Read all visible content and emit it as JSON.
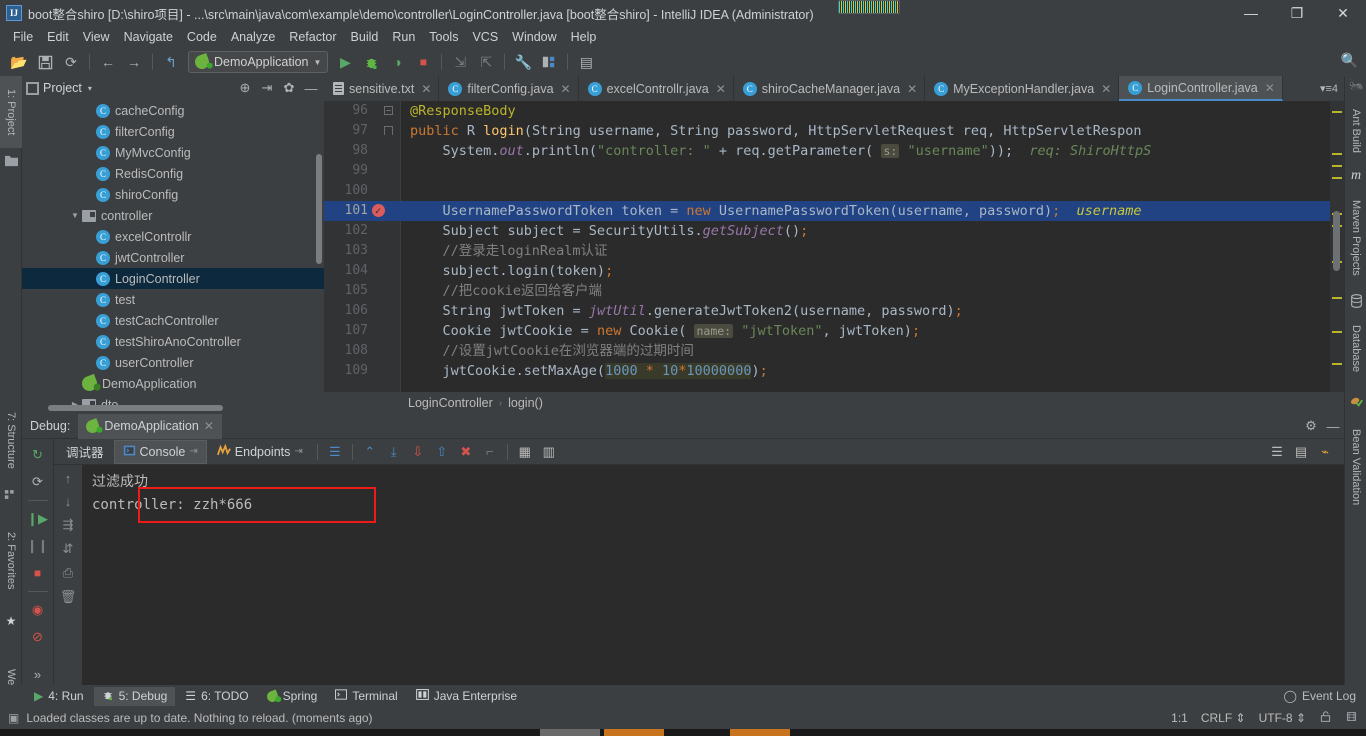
{
  "window": {
    "title": "boot整合shiro [D:\\shiro项目] - ...\\src\\main\\java\\com\\example\\demo\\controller\\LoginController.java [boot整合shiro] - IntelliJ IDEA (Administrator)",
    "app_icon": "IJ",
    "minimize": "—",
    "maximize": "❐",
    "close": "✕"
  },
  "menu": {
    "items": [
      "File",
      "Edit",
      "View",
      "Navigate",
      "Code",
      "Analyze",
      "Refactor",
      "Build",
      "Run",
      "Tools",
      "VCS",
      "Window",
      "Help"
    ]
  },
  "toolbar": {
    "open_icon": "📂",
    "save_icon": "💾",
    "sync_icon": "⟳",
    "back_icon": "←",
    "forward_icon": "→",
    "rollback_icon": "↰",
    "run_config": "DemoApplication",
    "run_icon": "▶",
    "debug_icon": "🐞",
    "run_coverage_icon": "◑",
    "stop_icon": "■",
    "attach_icon": "⇲",
    "profile_icon": "⇱",
    "settings_icon": "🔧",
    "project_structure_icon": "▧",
    "db_icon": "▤",
    "search_icon": "🔍"
  },
  "left_strip": {
    "tabs": [
      {
        "label": "1: Project",
        "active": true
      },
      {
        "label": "7: Structure",
        "active": false
      },
      {
        "label": "2: Favorites",
        "active": false
      },
      {
        "label": "Web",
        "active": false
      }
    ]
  },
  "right_strip": {
    "tabs": [
      {
        "label": "Ant Build"
      },
      {
        "label": "Maven Projects"
      },
      {
        "label": "Database"
      },
      {
        "label": "Bean Validation"
      }
    ]
  },
  "project_panel": {
    "title": "Project",
    "caret": "▾",
    "icons": [
      "collapse-all-icon",
      "expand-icon",
      "gear-icon",
      "hide-icon"
    ],
    "tree": [
      {
        "label": "cacheConfig",
        "indent": 4,
        "icon": "class",
        "arrow": "",
        "selected": false
      },
      {
        "label": "filterConfig",
        "indent": 4,
        "icon": "class",
        "arrow": "",
        "selected": false
      },
      {
        "label": "MyMvcConfig",
        "indent": 4,
        "icon": "class",
        "arrow": "",
        "selected": false
      },
      {
        "label": "RedisConfig",
        "indent": 4,
        "icon": "class",
        "arrow": "",
        "selected": false
      },
      {
        "label": "shiroConfig",
        "indent": 4,
        "icon": "class",
        "arrow": "",
        "selected": false
      },
      {
        "label": "controller",
        "indent": 3,
        "icon": "folder",
        "arrow": "▼",
        "selected": false
      },
      {
        "label": "excelControllr",
        "indent": 4,
        "icon": "class",
        "arrow": "",
        "selected": false
      },
      {
        "label": "jwtController",
        "indent": 4,
        "icon": "class",
        "arrow": "",
        "selected": false
      },
      {
        "label": "LoginController",
        "indent": 4,
        "icon": "class",
        "arrow": "",
        "selected": true
      },
      {
        "label": "test",
        "indent": 4,
        "icon": "class",
        "arrow": "",
        "selected": false
      },
      {
        "label": "testCachController",
        "indent": 4,
        "icon": "class",
        "arrow": "",
        "selected": false
      },
      {
        "label": "testShiroAnoController",
        "indent": 4,
        "icon": "class",
        "arrow": "",
        "selected": false
      },
      {
        "label": "userController",
        "indent": 4,
        "icon": "class",
        "arrow": "",
        "selected": false
      },
      {
        "label": "DemoApplication",
        "indent": 3,
        "icon": "app",
        "arrow": "",
        "selected": false
      },
      {
        "label": "dto",
        "indent": 3,
        "icon": "folder",
        "arrow": "▶",
        "selected": false
      }
    ]
  },
  "editor": {
    "tabs": [
      {
        "label": "sensitive.txt",
        "icon": "txt",
        "active": false
      },
      {
        "label": "filterConfig.java",
        "icon": "class",
        "active": false
      },
      {
        "label": "excelControllr.java",
        "icon": "class",
        "active": false
      },
      {
        "label": "shiroCacheManager.java",
        "icon": "class",
        "active": false
      },
      {
        "label": "MyExceptionHandler.java",
        "icon": "class",
        "active": false
      },
      {
        "label": "LoginController.java",
        "icon": "class",
        "active": true
      }
    ],
    "tab_overflow": "▾≡4",
    "breadcrumb": [
      "LoginController",
      "login()"
    ],
    "breadcrumb_sep": "›",
    "lines": [
      {
        "num": "96",
        "fold": "minus",
        "breakpoint": false,
        "highlight": false
      },
      {
        "num": "97",
        "fold": "arrow",
        "breakpoint": false,
        "highlight": false
      },
      {
        "num": "98",
        "fold": "",
        "breakpoint": false,
        "highlight": false
      },
      {
        "num": "99",
        "fold": "",
        "breakpoint": false,
        "highlight": false
      },
      {
        "num": "100",
        "fold": "",
        "breakpoint": false,
        "highlight": false
      },
      {
        "num": "101",
        "fold": "",
        "breakpoint": true,
        "highlight": true
      },
      {
        "num": "102",
        "fold": "",
        "breakpoint": false,
        "highlight": false
      },
      {
        "num": "103",
        "fold": "",
        "breakpoint": false,
        "highlight": false
      },
      {
        "num": "104",
        "fold": "",
        "breakpoint": false,
        "highlight": false
      },
      {
        "num": "105",
        "fold": "",
        "breakpoint": false,
        "highlight": false
      },
      {
        "num": "106",
        "fold": "",
        "breakpoint": false,
        "highlight": false
      },
      {
        "num": "107",
        "fold": "",
        "breakpoint": false,
        "highlight": false
      },
      {
        "num": "108",
        "fold": "",
        "breakpoint": false,
        "highlight": false
      },
      {
        "num": "109",
        "fold": "",
        "breakpoint": false,
        "highlight": false
      }
    ],
    "code_text": [
      "@ResponseBody",
      "public R login(String username, String password, HttpServletRequest req, HttpServletRespon",
      "    System.out.println(\"controller: \" + req.getParameter( s: \"username\"));   req: ShiroHttpS",
      "",
      "",
      "    UsernamePasswordToken token = new UsernamePasswordToken(username, password);   username",
      "    Subject subject = SecurityUtils.getSubject();",
      "    //登录走loginRealm认证",
      "    subject.login(token);",
      "    //把cookie返回给客户端",
      "    String jwtToken = jwtUtil.generateJwtToken2(username, password);",
      "    Cookie jwtCookie = new Cookie( name: \"jwtToken\", jwtToken);",
      "    //设置jwtCookie在浏览器端的过期时间",
      "    jwtCookie.setMaxAge(1000 * 10*10000000);"
    ]
  },
  "debug": {
    "header_label": "Debug:",
    "session_tab": "DemoApplication",
    "close_icon": "✕",
    "settings_icon": "⚙",
    "hide_icon": "—",
    "side_tools": [
      "rerun-icon",
      "restart-icon",
      "resume-icon",
      "pause-icon",
      "stop-icon",
      "mute-breakpoints-icon",
      "view-breakpoints-icon",
      "more-icon"
    ],
    "tabs": [
      {
        "label": "调试器",
        "active": false,
        "icon": ""
      },
      {
        "label": "Console",
        "active": true,
        "icon": "console",
        "sup": "⇥"
      },
      {
        "label": "Endpoints",
        "active": false,
        "icon": "endpoints",
        "sup": "⇥"
      }
    ],
    "toolbar_icons": [
      "wrap-icon",
      "up-stack-icon",
      "scroll-down-icon",
      "scroll-end-icon",
      "scroll-up-icon",
      "clear-icon",
      "kill-icon",
      "table-icon",
      "columns-icon"
    ],
    "right_icons": [
      "soft-wrap-icon",
      "browser-icon",
      "settings-icon"
    ],
    "gutter_icons": [
      "up-arrow-icon",
      "down-arrow-icon",
      "collapse-icon",
      "sort-icon",
      "print-icon",
      "trash-icon"
    ],
    "console_lines": [
      "过滤成功",
      "controller: zzh*666"
    ],
    "highlight_color": "#f01a1a"
  },
  "bottom_tabs": [
    {
      "label": "4: Run",
      "icon": "▶",
      "active": false
    },
    {
      "label": "5: Debug",
      "icon": "🐞",
      "active": true
    },
    {
      "label": "6: TODO",
      "icon": "☰",
      "active": false
    },
    {
      "label": "Spring",
      "icon": "🍃",
      "active": false
    },
    {
      "label": "Terminal",
      "icon": "▣",
      "active": false
    },
    {
      "label": "Java Enterprise",
      "icon": "▤",
      "active": false
    }
  ],
  "event_log": "Event Log",
  "event_log_icon": "◯",
  "status": {
    "message_icon": "▣",
    "message": "Loaded classes are up to date. Nothing to reload. (moments ago)",
    "caret_pos": "1:1",
    "line_sep": "CRLF",
    "encoding": "UTF-8",
    "updown": "⇕",
    "lock_icon": "🔓",
    "inspection_icon": "⌬"
  },
  "colors": {
    "accent": "#4a88c7",
    "selection": "#214283",
    "panel_bg": "#3c3f41",
    "editor_bg": "#2b2b2b",
    "tree_select": "#0d293e",
    "red_highlight": "#f01a1a",
    "spring_green": "#6db33f"
  }
}
